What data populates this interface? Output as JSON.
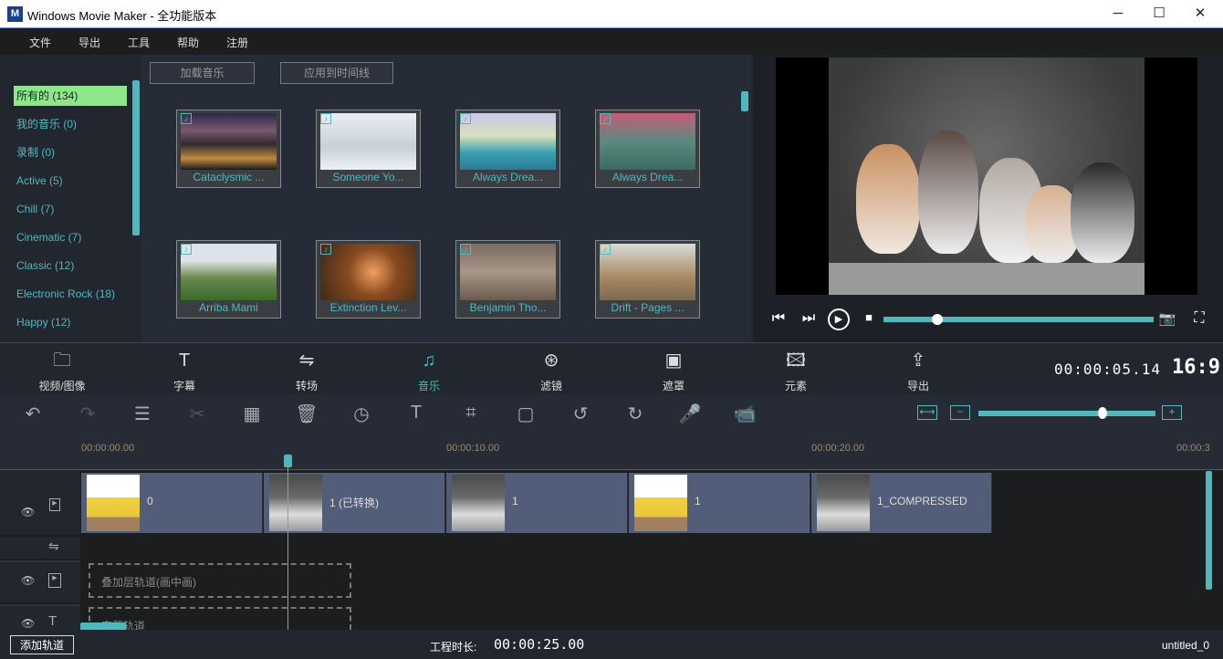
{
  "window": {
    "title": "Windows Movie Maker  - 全功能版本",
    "logo": "M",
    "minimize": "─",
    "maximize": "☐",
    "close": "✕"
  },
  "menu": [
    "文件",
    "导出",
    "工具",
    "帮助",
    "注册"
  ],
  "categories": [
    "所有的 (134)",
    "我的音乐 (0)",
    "录制 (0)",
    "Active (5)",
    "Chill (7)",
    "Cinematic (7)",
    "Classic (12)",
    "Electronic Rock (18)",
    "Happy (12)"
  ],
  "media": {
    "load_music": "加载音乐",
    "apply_timeline": "应用到时间线",
    "items": [
      {
        "label": "Cataclysmic ...",
        "bg": "linear-gradient(#2a2a45,#7a5a70 30%,#302a30 55%,#c08a40 80%,#1a1a1a)"
      },
      {
        "label": "Someone Yo...",
        "bg": "linear-gradient(#e8eef2,#c8d0d8 60%,#eef2f5)"
      },
      {
        "label": "Always Drea...",
        "bg": "linear-gradient(#c8c8e8,#d8e0c0 40%,#3aa0b0 70%,#2a7a9a)"
      },
      {
        "label": "Always Drea...",
        "bg": "linear-gradient(#c85a78,#5a8a80 50%,#3a6a60)"
      },
      {
        "label": "Arriba Mami",
        "bg": "linear-gradient(#d8e4ee,#e0e4e8 30%,#6a8a50 60%,#3a6a2a)"
      },
      {
        "label": "Extinction Lev...",
        "bg": "radial-gradient(circle at 55% 50%,#f0a060,#8a4a20 40%,#3a2a1a)"
      },
      {
        "label": "Benjamin Tho...",
        "bg": "linear-gradient(#7a6a60,#a89888 50%,#6a5a50)"
      },
      {
        "label": "Drift - Pages ...",
        "bg": "linear-gradient(#d8dcd8,#a88a60 60%,#7a6a50)"
      }
    ]
  },
  "player": {
    "prev": "⏮",
    "next": "⏭",
    "play": "▶",
    "stop": "■",
    "snapshot": "📷",
    "fullscreen": "⛶",
    "progress": 0.2
  },
  "tools": [
    {
      "icon": "🗀",
      "label": "视频/图像"
    },
    {
      "icon": "T",
      "label": "字幕"
    },
    {
      "icon": "⇋",
      "label": "转场"
    },
    {
      "icon": "♫",
      "label": "音乐"
    },
    {
      "icon": "⊛",
      "label": "滤镜"
    },
    {
      "icon": "▣",
      "label": "遮罩"
    },
    {
      "icon": "🖾",
      "label": "元素"
    },
    {
      "icon": "⇪",
      "label": "导出"
    }
  ],
  "active_tool": "音乐",
  "timecode": "00:00:05.14",
  "aspect": "16:9",
  "edit_icons": [
    "↶",
    "↷",
    "☰",
    "✂",
    "▦",
    "🗑",
    "◷",
    "T",
    "⌗",
    "▢",
    "↺",
    "↻",
    "🎤",
    "📹"
  ],
  "zoom": {
    "fit": "⟷",
    "minus": "−",
    "plus": "+",
    "level": 0.7
  },
  "ruler": [
    "00:00:00.00",
    "00:00:10.00",
    "00:00:20.00",
    "00:00:3"
  ],
  "clips": [
    {
      "label": "0",
      "type": "cartoon"
    },
    {
      "label": "1 (已转换)",
      "type": "dogs"
    },
    {
      "label": "1",
      "type": "dogs"
    },
    {
      "label": "1",
      "type": "cartoon"
    },
    {
      "label": "1_COMPRESSED",
      "type": "dogs"
    }
  ],
  "overlay_track": "叠加层轨道(画中画)",
  "text_track": "字幕轨道",
  "bottom": {
    "add_track": "添加轨道",
    "duration_label": "工程时长:",
    "duration": "00:00:25.00",
    "project": "untitled_0"
  },
  "colors": {
    "accent": "#4fb8bf",
    "selected": "#8de88c"
  }
}
